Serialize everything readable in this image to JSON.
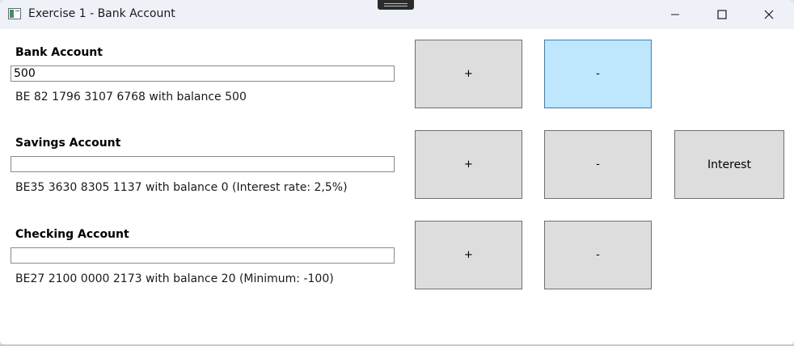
{
  "window": {
    "title": "Exercise 1 - Bank Account"
  },
  "accounts": {
    "bank": {
      "label": "Bank Account",
      "input_value": "500",
      "info": "BE 82 1796 3107 6768 with balance 500",
      "plus_label": "+",
      "minus_label": "-"
    },
    "savings": {
      "label": "Savings Account",
      "input_value": "",
      "info": "BE35 3630 8305 1137 with balance 0 (Interest rate: 2,5%)",
      "plus_label": "+",
      "minus_label": "-",
      "interest_label": "Interest"
    },
    "checking": {
      "label": "Checking Account",
      "input_value": "",
      "info": "BE27 2100 0000 2173 with balance 20 (Minimum: -100)",
      "plus_label": "+",
      "minus_label": "-"
    }
  },
  "colors": {
    "button_bg": "#dddddd",
    "button_hover_bg": "#bee6fd",
    "button_hover_border": "#3c7fb1",
    "titlebar_bg": "#eef2f8"
  },
  "icons": {
    "app": "app-window-icon",
    "minimize": "minimize-icon",
    "maximize": "maximize-icon",
    "close": "close-icon"
  }
}
